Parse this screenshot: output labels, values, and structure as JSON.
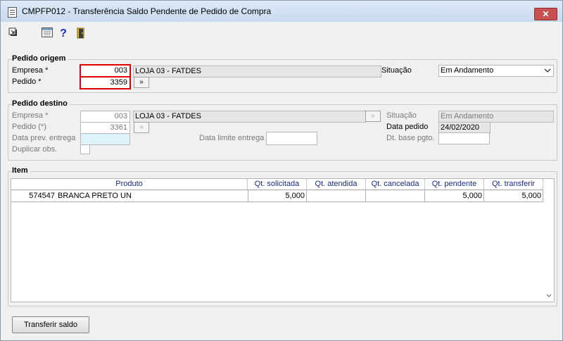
{
  "window": {
    "title": "CMPFP012 - Transferência Saldo Pendente de Pedido de Compra",
    "close_label": "✕"
  },
  "toolbar": {
    "icons": [
      "export-icon",
      "calculator-icon",
      "help-icon",
      "exit-door-icon"
    ],
    "help_glyph": "?"
  },
  "origem": {
    "legend": "Pedido origem",
    "empresa_label": "Empresa *",
    "empresa_value": "003",
    "empresa_nome": "LOJA 03 - FATDES",
    "pedido_label": "Pedido *",
    "pedido_value": "3359",
    "go_button": "»",
    "situacao_label": "Situação",
    "situacao_value": "Em Andamento"
  },
  "destino": {
    "legend": "Pedido destino",
    "empresa_label": "Empresa *",
    "empresa_value": "003",
    "empresa_nome": "LOJA 03 - FATDES",
    "pedido_label": "Pedido (*)",
    "pedido_value": "3361",
    "data_prev_label": "Data prev. entrega",
    "data_prev_value": "",
    "duplicar_label": "Duplicar obs.",
    "data_limite_label": "Data limite entrega",
    "data_limite_value": "",
    "situacao_label": "Situação",
    "situacao_value": "Em Andamento",
    "data_pedido_label": "Data pedido",
    "data_pedido_value": "24/02/2020",
    "dt_base_label": "Dt. base pgto.",
    "dt_base_value": "",
    "lookup_button": "»"
  },
  "item": {
    "legend": "Item",
    "columns": [
      "Produto",
      "Qt. solicitada",
      "Qt. atendida",
      "Qt. cancelada",
      "Qt. pendente",
      "Qt. transferir"
    ],
    "rows": [
      {
        "codigo": "574547",
        "produto": "BRANCA PRETO UN",
        "solicitada": "5,000",
        "atendida": "",
        "cancelada": "",
        "pendente": "5,000",
        "transferir": "5,000"
      }
    ]
  },
  "actions": {
    "transferir_label": "Transferir saldo"
  }
}
